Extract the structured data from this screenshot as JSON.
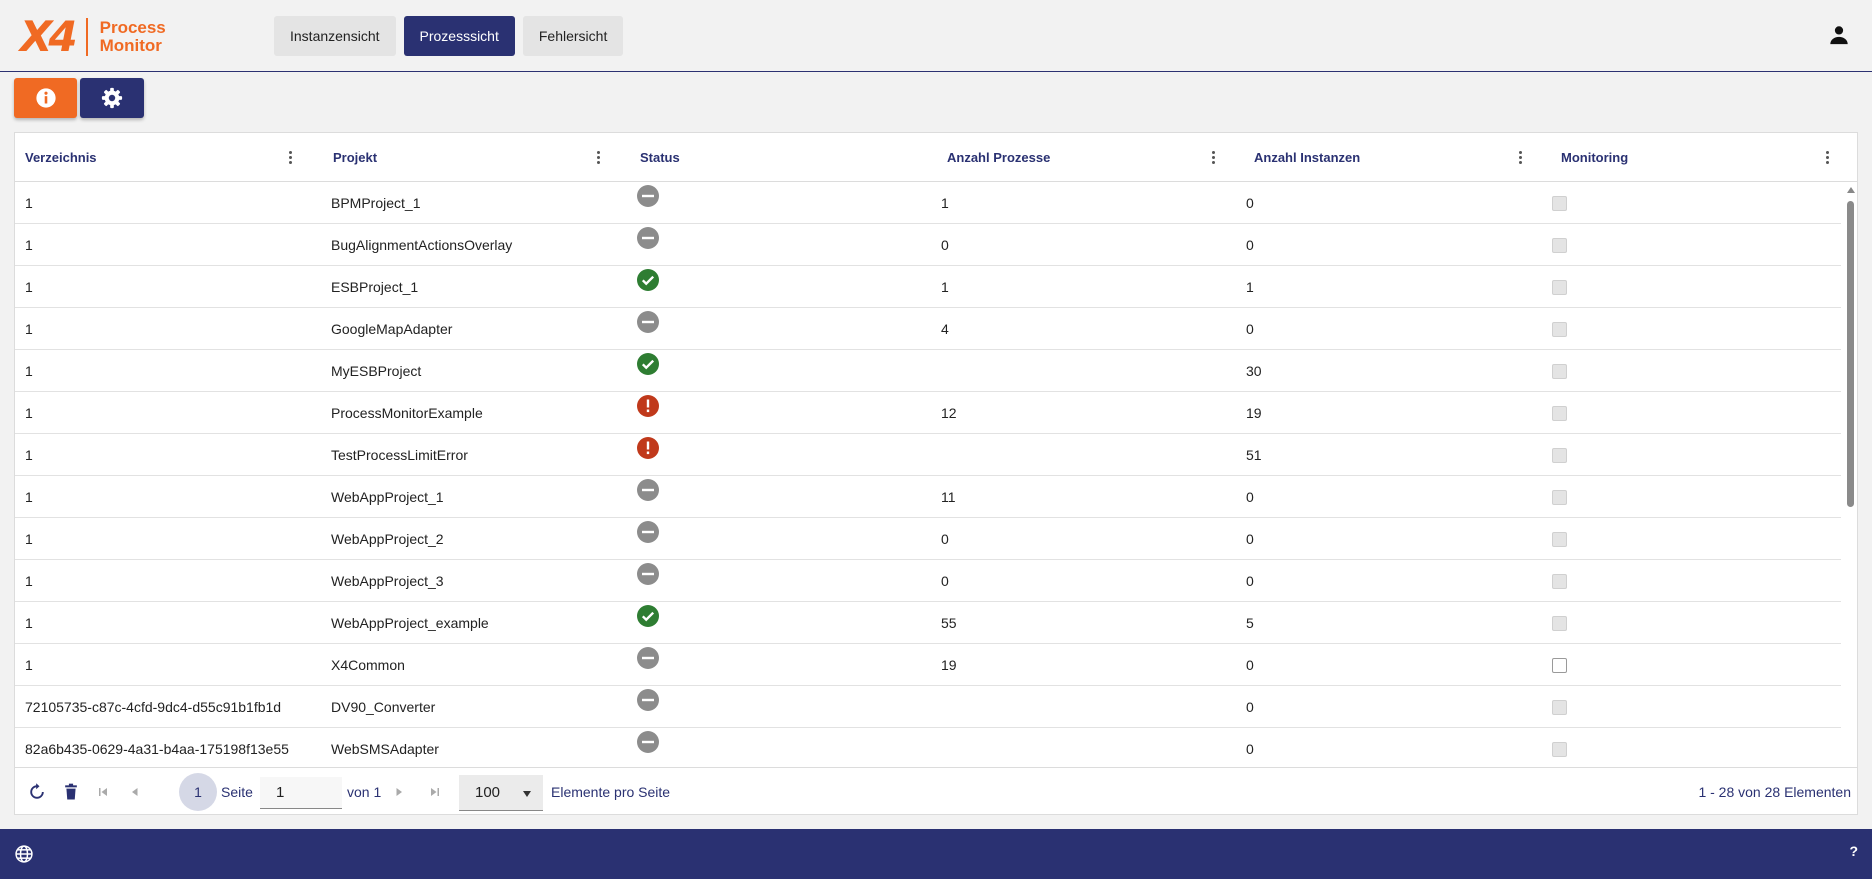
{
  "app": {
    "logo_mark": "X4",
    "logo_line1": "Process",
    "logo_line2": "Monitor"
  },
  "nav": {
    "tabs": [
      {
        "label": "Instanzensicht",
        "active": false
      },
      {
        "label": "Prozesssicht",
        "active": true
      },
      {
        "label": "Fehlersicht",
        "active": false
      }
    ]
  },
  "toolbar": {
    "info_icon": "info-icon",
    "settings_icon": "gear-icon"
  },
  "grid": {
    "columns": [
      "Verzeichnis",
      "Projekt",
      "Status",
      "Anzahl Prozesse",
      "Anzahl Instanzen",
      "Monitoring"
    ],
    "rows": [
      {
        "verzeichnis": "1",
        "projekt": "BPMProject_1",
        "status": "inactive",
        "prozesse": "1",
        "instanzen": "0",
        "monitoring": true
      },
      {
        "verzeichnis": "1",
        "projekt": "BugAlignmentActionsOverlay",
        "status": "inactive",
        "prozesse": "0",
        "instanzen": "0",
        "monitoring": true
      },
      {
        "verzeichnis": "1",
        "projekt": "ESBProject_1",
        "status": "ok",
        "prozesse": "1",
        "instanzen": "1",
        "monitoring": true
      },
      {
        "verzeichnis": "1",
        "projekt": "GoogleMapAdapter",
        "status": "inactive",
        "prozesse": "4",
        "instanzen": "0",
        "monitoring": true
      },
      {
        "verzeichnis": "1",
        "projekt": "MyESBProject",
        "status": "ok",
        "prozesse": "",
        "instanzen": "30",
        "monitoring": true
      },
      {
        "verzeichnis": "1",
        "projekt": "ProcessMonitorExample",
        "status": "error",
        "prozesse": "12",
        "instanzen": "19",
        "monitoring": true
      },
      {
        "verzeichnis": "1",
        "projekt": "TestProcessLimitError",
        "status": "error",
        "prozesse": "",
        "instanzen": "51",
        "monitoring": true
      },
      {
        "verzeichnis": "1",
        "projekt": "WebAppProject_1",
        "status": "inactive",
        "prozesse": "11",
        "instanzen": "0",
        "monitoring": true
      },
      {
        "verzeichnis": "1",
        "projekt": "WebAppProject_2",
        "status": "inactive",
        "prozesse": "0",
        "instanzen": "0",
        "monitoring": true
      },
      {
        "verzeichnis": "1",
        "projekt": "WebAppProject_3",
        "status": "inactive",
        "prozesse": "0",
        "instanzen": "0",
        "monitoring": true
      },
      {
        "verzeichnis": "1",
        "projekt": "WebAppProject_example",
        "status": "ok",
        "prozesse": "55",
        "instanzen": "5",
        "monitoring": true
      },
      {
        "verzeichnis": "1",
        "projekt": "X4Common",
        "status": "inactive",
        "prozesse": "19",
        "instanzen": "0",
        "monitoring": false
      },
      {
        "verzeichnis": "72105735-c87c-4cfd-9dc4-d55c91b1fb1d",
        "projekt": "DV90_Converter",
        "status": "inactive",
        "prozesse": "",
        "instanzen": "0",
        "monitoring": true
      },
      {
        "verzeichnis": "82a6b435-0629-4a31-b4aa-175198f13e55",
        "projekt": "WebSMSAdapter",
        "status": "inactive",
        "prozesse": "",
        "instanzen": "0",
        "monitoring": true
      }
    ]
  },
  "pager": {
    "current_page": "1",
    "page_label": "Seite",
    "page_input": "1",
    "of_label": "von 1",
    "page_size": "100",
    "page_size_label": "Elemente pro Seite",
    "summary": "1 - 28 von 28 Elementen"
  },
  "footer": {
    "help": "?"
  },
  "colors": {
    "brand_orange": "#f06a23",
    "brand_navy": "#2a3172",
    "status_ok": "#2e7d32",
    "status_error": "#c0391b",
    "status_inactive": "#8c8c8c"
  }
}
